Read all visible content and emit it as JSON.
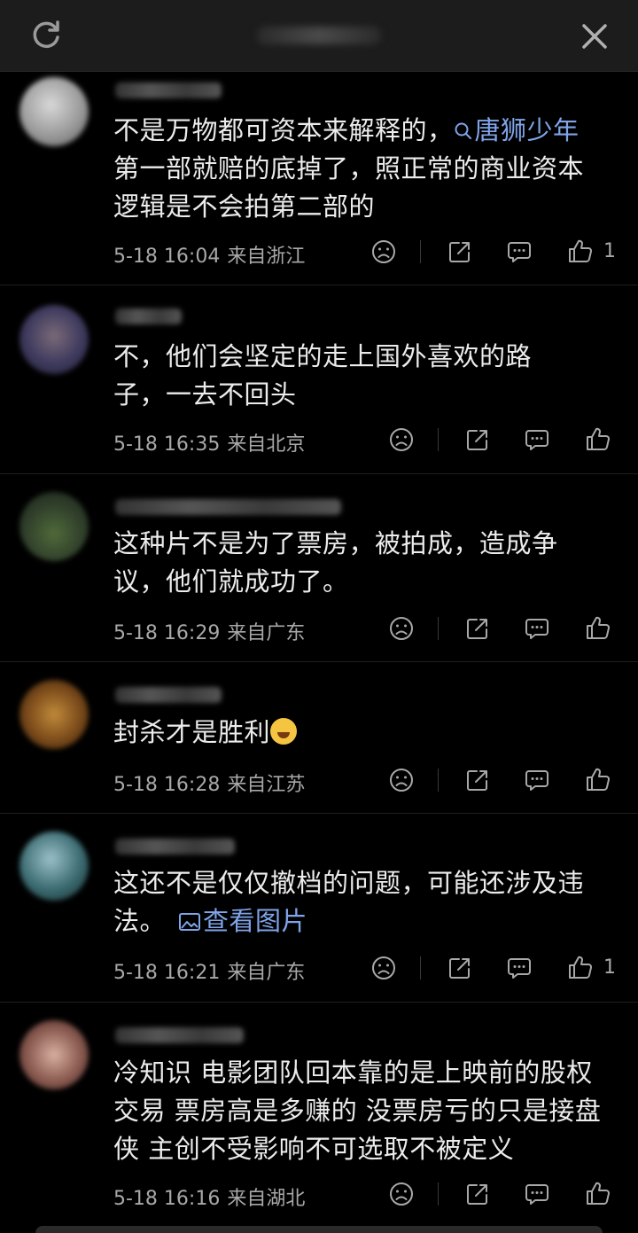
{
  "colors": {
    "background": "#000000",
    "link": "#7fa4e8",
    "meta": "#a8a8a8",
    "text": "#ececec"
  },
  "topbar": {
    "refresh_icon": "refresh-icon",
    "close_icon": "close-icon"
  },
  "comments": [
    {
      "text_before": "不是万物都可资本来解释的，",
      "link": "唐狮少年",
      "text_after": " 第一部就赔的底掉了，照正常的商业资本逻辑是不会拍第二部的",
      "date": "5-18 16:04",
      "place": "来自浙江",
      "likes": "1"
    },
    {
      "text": "不，他们会坚定的走上国外喜欢的路子，一去不回头",
      "date": "5-18 16:35",
      "place": "来自北京",
      "likes": ""
    },
    {
      "text": "这种片不是为了票房，被拍成，造成争议，他们就成功了。",
      "date": "5-18 16:29",
      "place": "来自广东",
      "likes": ""
    },
    {
      "text": "封杀才是胜利",
      "date": "5-18 16:28",
      "place": "来自江苏",
      "likes": ""
    },
    {
      "text": "这还不是仅仅撤档的问题，可能还涉及违法。",
      "link": "查看图片",
      "date": "5-18 16:21",
      "place": "来自广东",
      "likes": "1"
    },
    {
      "text": "冷知识 电影团队回本靠的是上映前的股权交易 票房高是多赚的 没票房亏的只是接盘侠 主创不受影响不可选取不被定义",
      "date": "5-18 16:16",
      "place": "来自湖北",
      "likes": ""
    }
  ]
}
